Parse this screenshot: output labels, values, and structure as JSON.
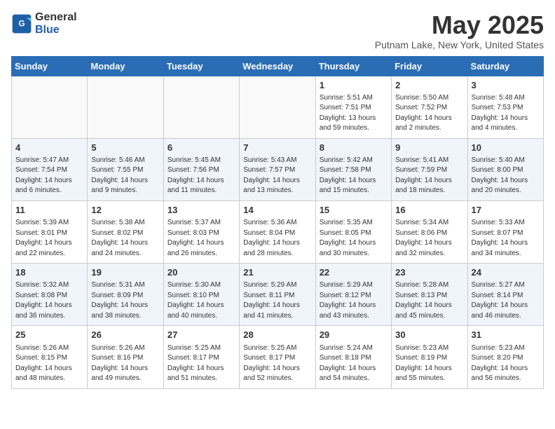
{
  "header": {
    "logo_general": "General",
    "logo_blue": "Blue",
    "month_year": "May 2025",
    "location": "Putnam Lake, New York, United States"
  },
  "days_of_week": [
    "Sunday",
    "Monday",
    "Tuesday",
    "Wednesday",
    "Thursday",
    "Friday",
    "Saturday"
  ],
  "weeks": [
    [
      {
        "day": "",
        "info": ""
      },
      {
        "day": "",
        "info": ""
      },
      {
        "day": "",
        "info": ""
      },
      {
        "day": "",
        "info": ""
      },
      {
        "day": "1",
        "info": "Sunrise: 5:51 AM\nSunset: 7:51 PM\nDaylight: 13 hours\nand 59 minutes."
      },
      {
        "day": "2",
        "info": "Sunrise: 5:50 AM\nSunset: 7:52 PM\nDaylight: 14 hours\nand 2 minutes."
      },
      {
        "day": "3",
        "info": "Sunrise: 5:48 AM\nSunset: 7:53 PM\nDaylight: 14 hours\nand 4 minutes."
      }
    ],
    [
      {
        "day": "4",
        "info": "Sunrise: 5:47 AM\nSunset: 7:54 PM\nDaylight: 14 hours\nand 6 minutes."
      },
      {
        "day": "5",
        "info": "Sunrise: 5:46 AM\nSunset: 7:55 PM\nDaylight: 14 hours\nand 9 minutes."
      },
      {
        "day": "6",
        "info": "Sunrise: 5:45 AM\nSunset: 7:56 PM\nDaylight: 14 hours\nand 11 minutes."
      },
      {
        "day": "7",
        "info": "Sunrise: 5:43 AM\nSunset: 7:57 PM\nDaylight: 14 hours\nand 13 minutes."
      },
      {
        "day": "8",
        "info": "Sunrise: 5:42 AM\nSunset: 7:58 PM\nDaylight: 14 hours\nand 15 minutes."
      },
      {
        "day": "9",
        "info": "Sunrise: 5:41 AM\nSunset: 7:59 PM\nDaylight: 14 hours\nand 18 minutes."
      },
      {
        "day": "10",
        "info": "Sunrise: 5:40 AM\nSunset: 8:00 PM\nDaylight: 14 hours\nand 20 minutes."
      }
    ],
    [
      {
        "day": "11",
        "info": "Sunrise: 5:39 AM\nSunset: 8:01 PM\nDaylight: 14 hours\nand 22 minutes."
      },
      {
        "day": "12",
        "info": "Sunrise: 5:38 AM\nSunset: 8:02 PM\nDaylight: 14 hours\nand 24 minutes."
      },
      {
        "day": "13",
        "info": "Sunrise: 5:37 AM\nSunset: 8:03 PM\nDaylight: 14 hours\nand 26 minutes."
      },
      {
        "day": "14",
        "info": "Sunrise: 5:36 AM\nSunset: 8:04 PM\nDaylight: 14 hours\nand 28 minutes."
      },
      {
        "day": "15",
        "info": "Sunrise: 5:35 AM\nSunset: 8:05 PM\nDaylight: 14 hours\nand 30 minutes."
      },
      {
        "day": "16",
        "info": "Sunrise: 5:34 AM\nSunset: 8:06 PM\nDaylight: 14 hours\nand 32 minutes."
      },
      {
        "day": "17",
        "info": "Sunrise: 5:33 AM\nSunset: 8:07 PM\nDaylight: 14 hours\nand 34 minutes."
      }
    ],
    [
      {
        "day": "18",
        "info": "Sunrise: 5:32 AM\nSunset: 8:08 PM\nDaylight: 14 hours\nand 36 minutes."
      },
      {
        "day": "19",
        "info": "Sunrise: 5:31 AM\nSunset: 8:09 PM\nDaylight: 14 hours\nand 38 minutes."
      },
      {
        "day": "20",
        "info": "Sunrise: 5:30 AM\nSunset: 8:10 PM\nDaylight: 14 hours\nand 40 minutes."
      },
      {
        "day": "21",
        "info": "Sunrise: 5:29 AM\nSunset: 8:11 PM\nDaylight: 14 hours\nand 41 minutes."
      },
      {
        "day": "22",
        "info": "Sunrise: 5:29 AM\nSunset: 8:12 PM\nDaylight: 14 hours\nand 43 minutes."
      },
      {
        "day": "23",
        "info": "Sunrise: 5:28 AM\nSunset: 8:13 PM\nDaylight: 14 hours\nand 45 minutes."
      },
      {
        "day": "24",
        "info": "Sunrise: 5:27 AM\nSunset: 8:14 PM\nDaylight: 14 hours\nand 46 minutes."
      }
    ],
    [
      {
        "day": "25",
        "info": "Sunrise: 5:26 AM\nSunset: 8:15 PM\nDaylight: 14 hours\nand 48 minutes."
      },
      {
        "day": "26",
        "info": "Sunrise: 5:26 AM\nSunset: 8:16 PM\nDaylight: 14 hours\nand 49 minutes."
      },
      {
        "day": "27",
        "info": "Sunrise: 5:25 AM\nSunset: 8:17 PM\nDaylight: 14 hours\nand 51 minutes."
      },
      {
        "day": "28",
        "info": "Sunrise: 5:25 AM\nSunset: 8:17 PM\nDaylight: 14 hours\nand 52 minutes."
      },
      {
        "day": "29",
        "info": "Sunrise: 5:24 AM\nSunset: 8:18 PM\nDaylight: 14 hours\nand 54 minutes."
      },
      {
        "day": "30",
        "info": "Sunrise: 5:23 AM\nSunset: 8:19 PM\nDaylight: 14 hours\nand 55 minutes."
      },
      {
        "day": "31",
        "info": "Sunrise: 5:23 AM\nSunset: 8:20 PM\nDaylight: 14 hours\nand 56 minutes."
      }
    ]
  ]
}
